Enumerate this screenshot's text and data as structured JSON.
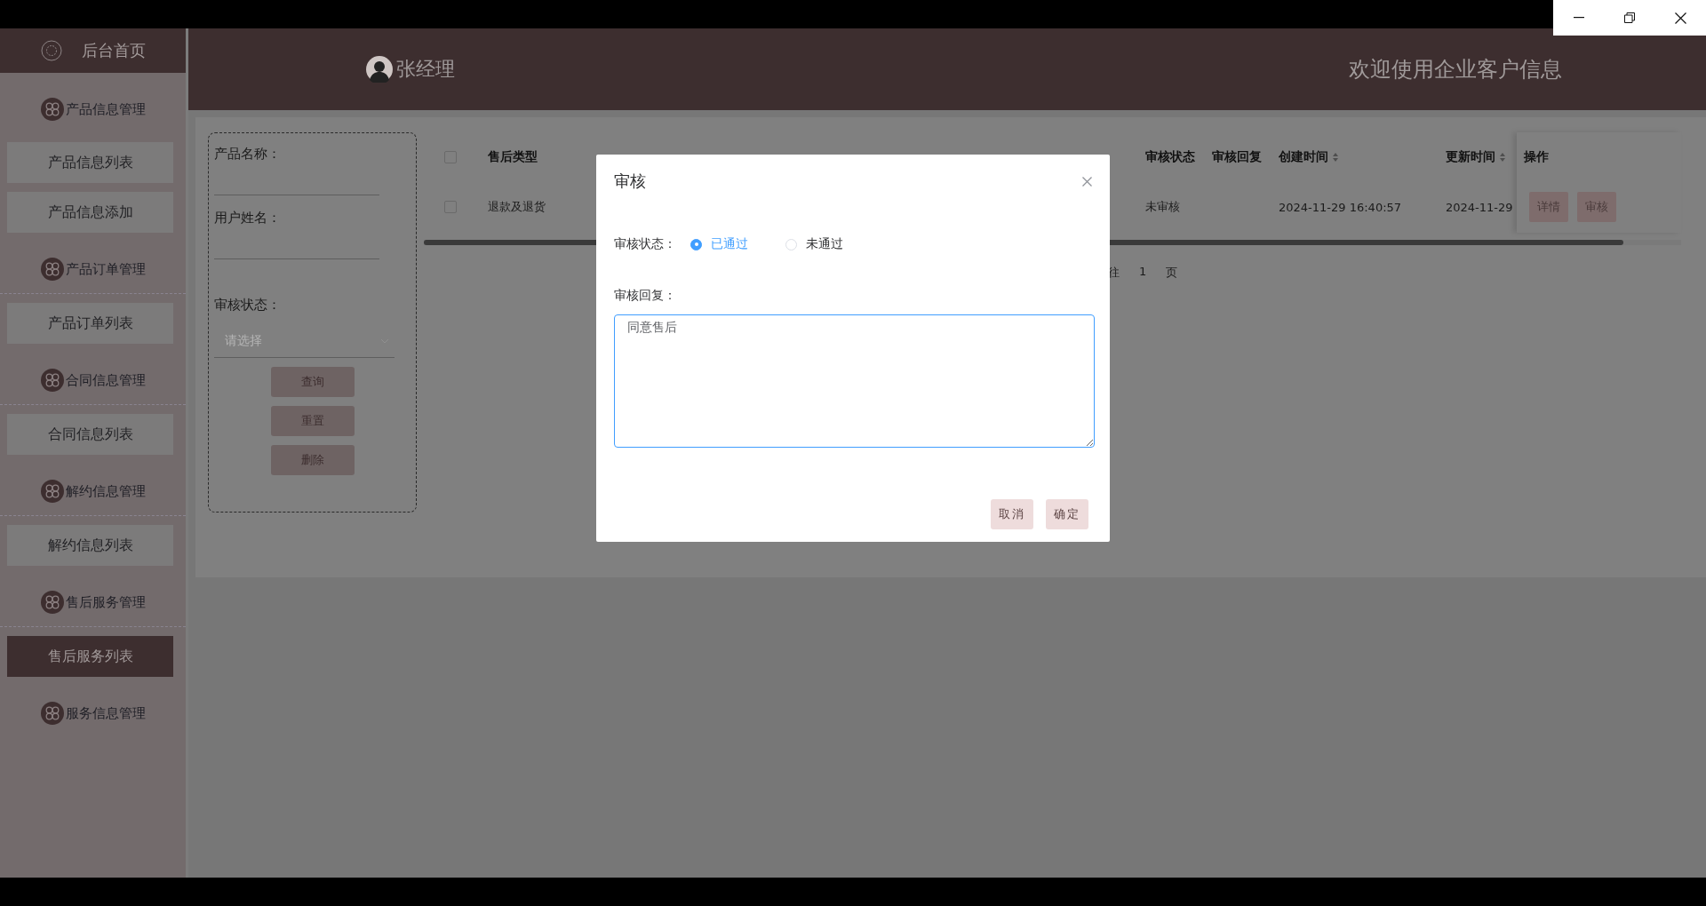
{
  "sidebar": {
    "home": "后台首页",
    "groups": [
      {
        "label": "产品信息管理",
        "items": [
          {
            "label": "产品信息列表",
            "selected": false
          },
          {
            "label": "产品信息添加",
            "selected": false
          }
        ]
      },
      {
        "label": "产品订单管理",
        "items": [
          {
            "label": "产品订单列表",
            "selected": false
          }
        ]
      },
      {
        "label": "合同信息管理",
        "items": [
          {
            "label": "合同信息列表",
            "selected": false
          }
        ]
      },
      {
        "label": "解约信息管理",
        "items": [
          {
            "label": "解约信息列表",
            "selected": false
          }
        ]
      },
      {
        "label": "售后服务管理",
        "items": [
          {
            "label": "售后服务列表",
            "selected": true
          }
        ]
      },
      {
        "label": "服务信息管理"
      }
    ]
  },
  "header": {
    "user": "张经理",
    "welcome": "欢迎使用企业客户信息"
  },
  "filter": {
    "fields": [
      {
        "label": "产品名称："
      },
      {
        "label": "用户姓名："
      }
    ],
    "status_label": "审核状态：",
    "select_placeholder": "请选择",
    "buttons": [
      "查询",
      "重置",
      "删除"
    ]
  },
  "table": {
    "select_all_checked": false,
    "columns": [
      {
        "label": "售后类型",
        "sortable": false
      },
      {
        "label": "审核状态",
        "sortable": false
      },
      {
        "label": "审核回复",
        "sortable": false
      },
      {
        "label": "创建时间",
        "sortable": true
      },
      {
        "label": "更新时间",
        "sortable": true
      },
      {
        "label": "操作",
        "sortable": false
      }
    ],
    "rows": [
      {
        "checked": false,
        "cells": [
          "退款及退货",
          "未审核",
          "",
          "2024-11-29 16:40:57",
          "2024-11-29"
        ],
        "actions": [
          "详情",
          "审核"
        ]
      }
    ]
  },
  "pagination": {
    "go_label": "往",
    "page": "1",
    "unit": "页"
  },
  "dialog": {
    "title": "审核",
    "status_label": "审核状态：",
    "status_options": [
      {
        "label": "已通过",
        "selected": true
      },
      {
        "label": "未通过",
        "selected": false
      }
    ],
    "reply_label": "审核回复：",
    "reply_value": "同意售后",
    "buttons": [
      "取消",
      "确定"
    ]
  }
}
